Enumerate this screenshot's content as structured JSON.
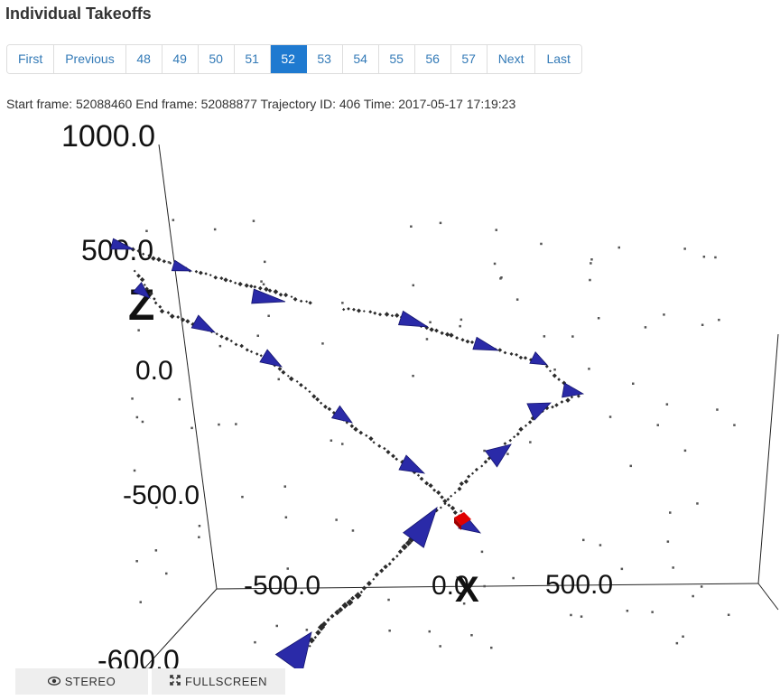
{
  "page": {
    "title": "Individual Takeoffs"
  },
  "pagination": {
    "first": "First",
    "previous": "Previous",
    "pages": [
      "48",
      "49",
      "50",
      "51",
      "52",
      "53",
      "54",
      "55",
      "56",
      "57"
    ],
    "active": "52",
    "next": "Next",
    "last": "Last"
  },
  "frame_info": "Start frame: 52088460 End frame: 52088877 Trajectory ID: 406 Time: 2017-05-17 17:19:23",
  "viewer": {
    "axis_labels": {
      "z": "Z",
      "x": "X",
      "z_ticks": [
        "1000.0",
        "500.0",
        "0.0",
        "-500.0",
        "-600.0"
      ],
      "x_ticks": [
        "-500.0",
        "0.0",
        "500.0"
      ]
    },
    "colors": {
      "cone": "#2a2aa8",
      "track_point": "#2b2b2b",
      "current_position": "#e00000",
      "axis_line": "#222222"
    }
  },
  "buttons": {
    "stereo": {
      "icon": "eye-icon",
      "label": "STEREO"
    },
    "fullscreen": {
      "icon": "expand-icon",
      "label": "FULLSCREEN"
    }
  }
}
